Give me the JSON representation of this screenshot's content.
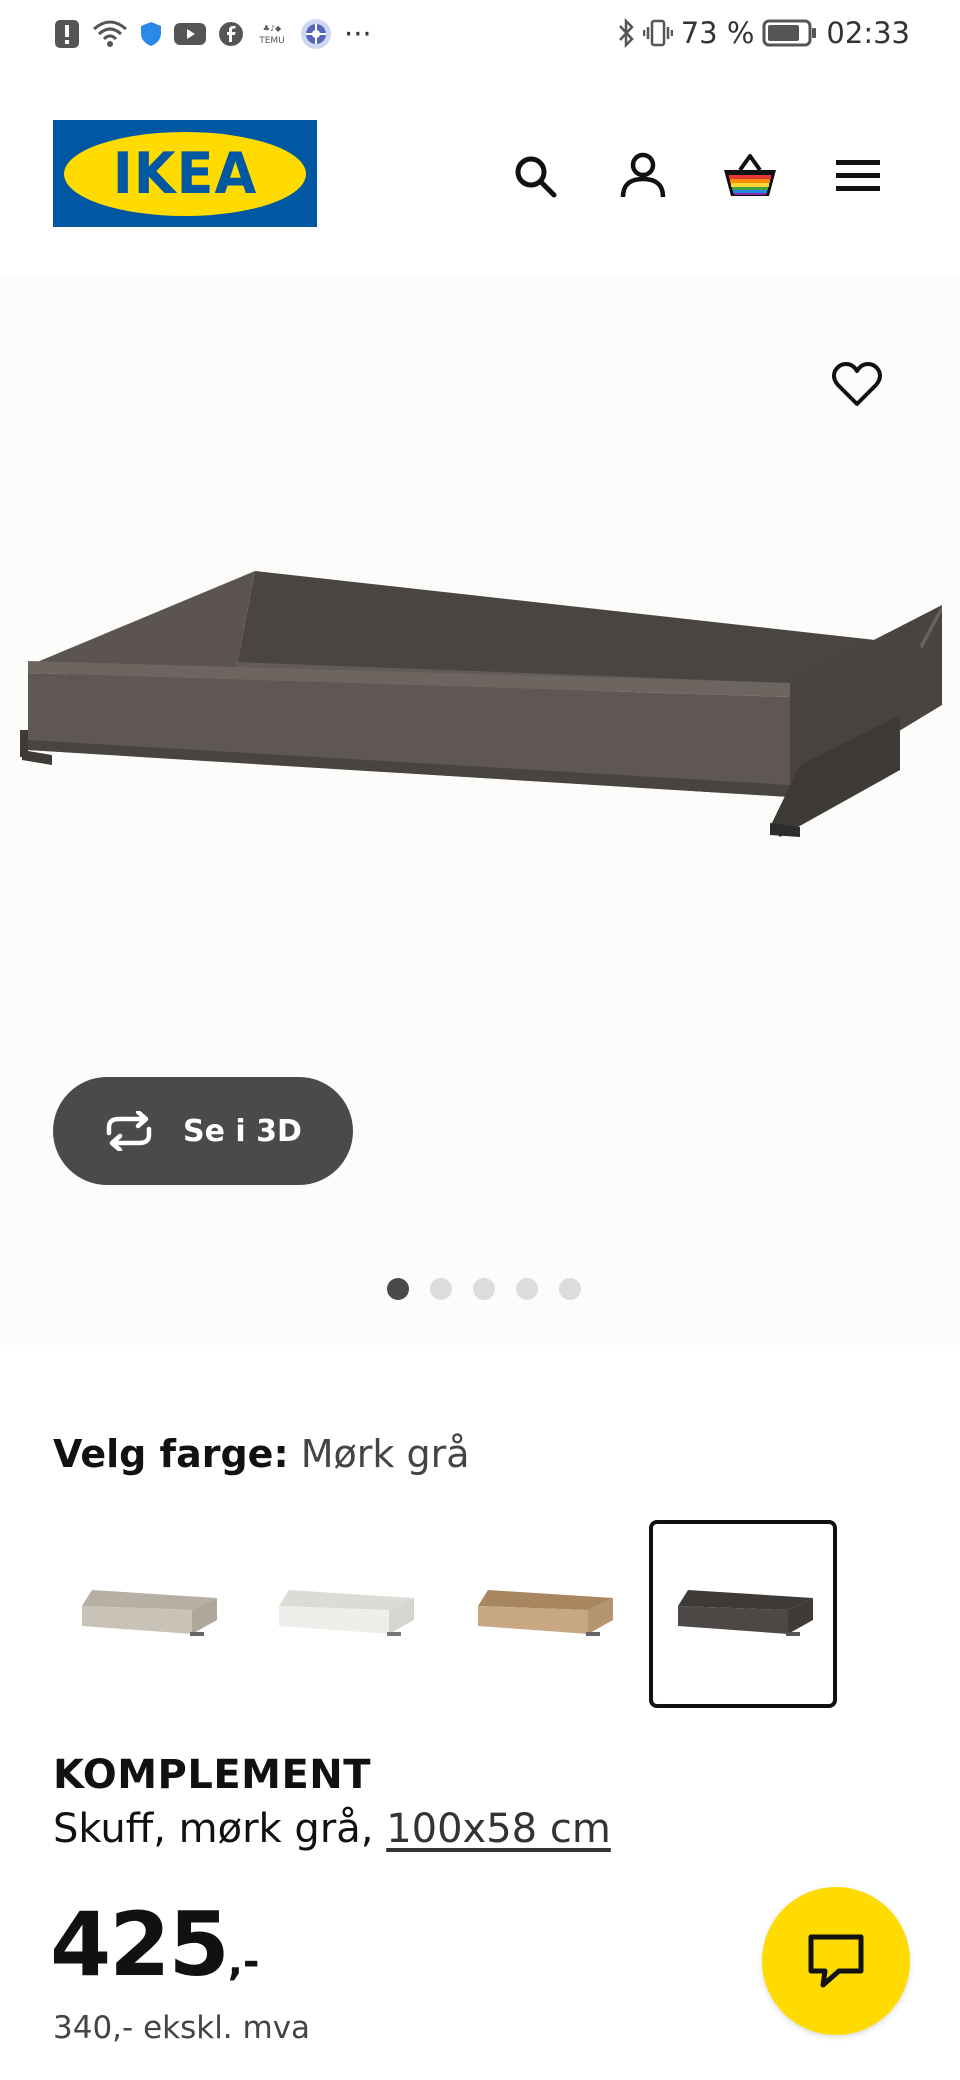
{
  "status_bar": {
    "battery_percent": "73 %",
    "time": "02:33",
    "more_icons": "···",
    "temu_label": "TEMU"
  },
  "header": {
    "logo_text": "IKEA",
    "icons": [
      "search-icon",
      "account-icon",
      "cart-icon",
      "menu-icon"
    ]
  },
  "hero": {
    "view_3d_label": "Se i 3D",
    "carousel": {
      "count": 5,
      "active_index": 0
    }
  },
  "color_selector": {
    "label": "Velg farge:",
    "selected_value": "Mørk grå",
    "options": [
      {
        "color": "#c9c2b6",
        "selected": false
      },
      {
        "color": "#eeeeea",
        "selected": false
      },
      {
        "color": "#c8a882",
        "selected": false
      },
      {
        "color": "#4d4845",
        "selected": true
      }
    ]
  },
  "product": {
    "name": "KOMPLEMENT",
    "description_prefix": "Skuff, mørk grå, ",
    "size_link": "100x58 cm",
    "price_integer": "425",
    "price_suffix": ",-",
    "price_ex_vat": "340,- ekskl. mva"
  },
  "colors": {
    "ikea_blue": "#0058a3",
    "ikea_yellow": "#ffdb00",
    "button_dark": "#4a4a4a"
  }
}
